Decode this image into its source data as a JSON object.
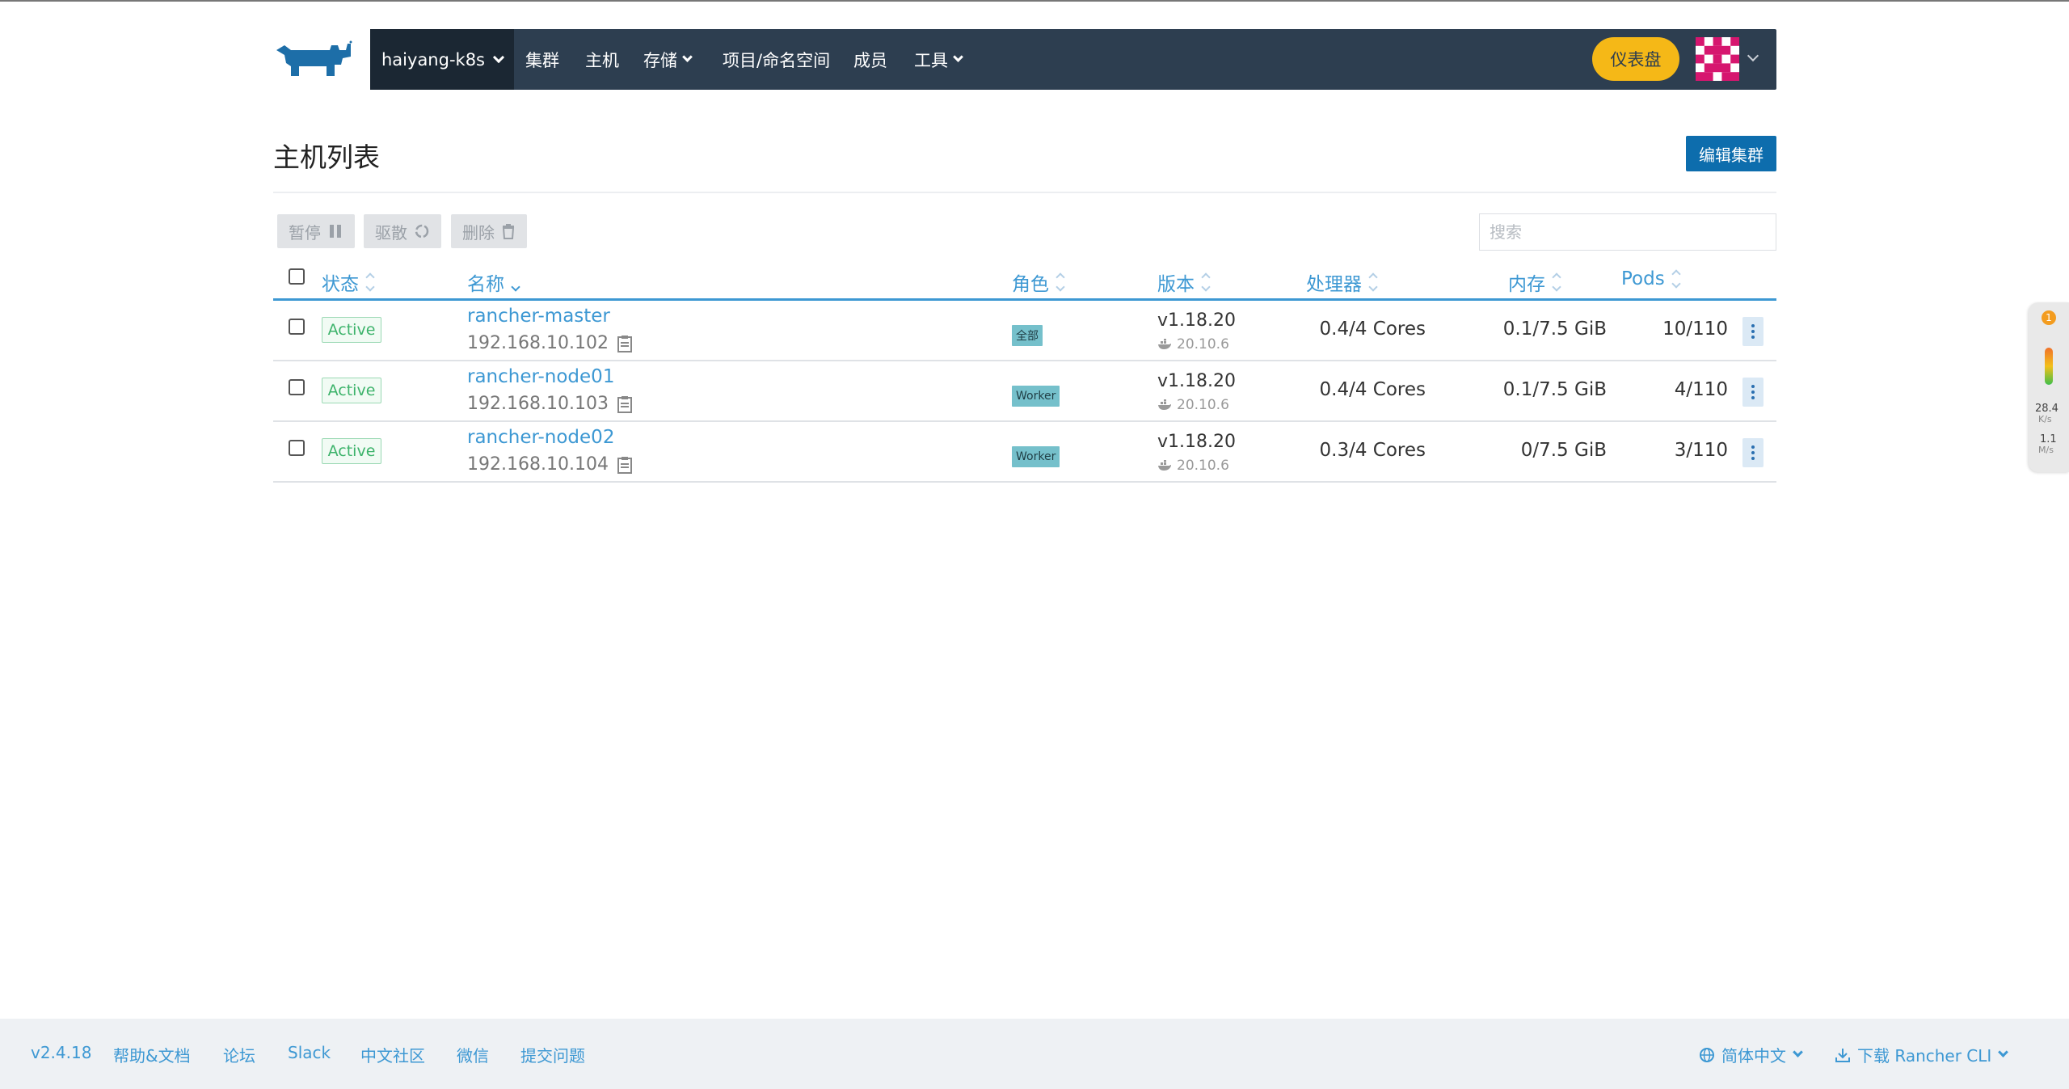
{
  "nav": {
    "cluster": "haiyang-k8s",
    "items": [
      {
        "label": "集群",
        "dropdown": false
      },
      {
        "label": "主机",
        "dropdown": false
      },
      {
        "label": "存储",
        "dropdown": true
      },
      {
        "label": "项目/命名空间",
        "dropdown": false
      },
      {
        "label": "成员",
        "dropdown": false
      },
      {
        "label": "工具",
        "dropdown": true
      }
    ],
    "dashboard": "仪表盘"
  },
  "page": {
    "title": "主机列表",
    "edit_button": "编辑集群"
  },
  "actions": {
    "pause": "暂停",
    "drain": "驱散",
    "delete": "删除",
    "search_placeholder": "搜索"
  },
  "table": {
    "columns": {
      "state": "状态",
      "name": "名称",
      "role": "角色",
      "version": "版本",
      "cpu": "处理器",
      "memory": "内存",
      "pods": "Pods"
    },
    "rows": [
      {
        "state": "Active",
        "name": "rancher-master",
        "ip": "192.168.10.102",
        "role": "全部",
        "version": "v1.18.20",
        "docker": "20.10.6",
        "cpu": "0.4/4 Cores",
        "memory": "0.1/7.5 GiB",
        "pods": "10/110"
      },
      {
        "state": "Active",
        "name": "rancher-node01",
        "ip": "192.168.10.103",
        "role": "Worker",
        "version": "v1.18.20",
        "docker": "20.10.6",
        "cpu": "0.4/4 Cores",
        "memory": "0.1/7.5 GiB",
        "pods": "4/110"
      },
      {
        "state": "Active",
        "name": "rancher-node02",
        "ip": "192.168.10.104",
        "role": "Worker",
        "version": "v1.18.20",
        "docker": "20.10.6",
        "cpu": "0.3/4 Cores",
        "memory": "0/7.5 GiB",
        "pods": "3/110"
      }
    ]
  },
  "widget": {
    "count": "1",
    "up_value": "28.4",
    "up_unit": "K/s",
    "down_value": "1.1",
    "down_unit": "M/s"
  },
  "footer": {
    "version": "v2.4.18",
    "links": [
      "帮助&文档",
      "论坛",
      "Slack",
      "中文社区",
      "微信",
      "提交问题"
    ],
    "language": "简体中文",
    "cli": "下载 Rancher CLI"
  },
  "colors": {
    "navbar": "#2d3e50",
    "accent": "#3d98d3",
    "dashboard": "#f5b817",
    "edit_button": "#0d6dad",
    "active": "#3db36b"
  }
}
